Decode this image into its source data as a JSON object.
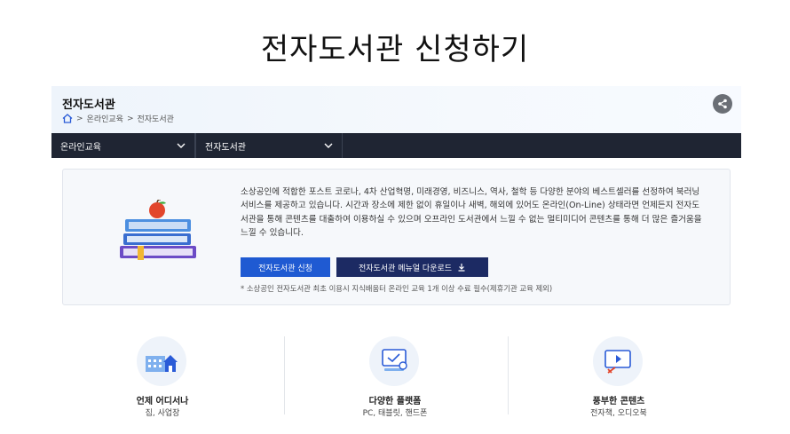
{
  "slide_title": "전자도서관 신청하기",
  "header": {
    "page_name": "전자도서관",
    "breadcrumb": [
      "온라인교육",
      "전자도서관"
    ],
    "share_icon": "share-icon"
  },
  "nav": {
    "items": [
      {
        "label": "온라인교육"
      },
      {
        "label": "전자도서관"
      }
    ]
  },
  "info": {
    "description": "소상공인에 적합한 포스트 코로나, 4차 산업혁명, 미래경영, 비즈니스, 역사, 철학 등 다양한 분야의 베스트셀러를 선정하여 북러닝 서비스를 제공하고 있습니다. 시간과 장소에 제한 없이 휴일이나 새벽, 해외에 있어도 온라인(On-Line) 상태라면 언제든지 전자도서관을 통해 콘텐츠를 대출하여 이용하실 수 있으며 오프라인 도서관에서 느낄 수 없는 멀티미디어 콘텐츠를 통해 더 많은 즐거움을 느낄 수 있습니다.",
    "apply_button": "전자도서관 신청",
    "manual_button": "전자도서관 메뉴얼 다운로드",
    "note": "* 소상공인 전자도서관 최초 이용시 지식배움터 온라인 교육 1개 이상 수료 필수(제휴기관 교육 제외)"
  },
  "features": [
    {
      "title": "언제 어디서나",
      "subtitle": "집, 사업장",
      "icon": "building-icon"
    },
    {
      "title": "다양한 플랫폼",
      "subtitle": "PC, 태블릿, 핸드폰",
      "icon": "devices-icon"
    },
    {
      "title": "풍부한 콘텐츠",
      "subtitle": "전자책, 오디오북",
      "icon": "media-content-icon"
    }
  ],
  "colors": {
    "navbar": "#1f2533",
    "primary_button": "#1f5ad2",
    "secondary_button": "#1c2a63"
  }
}
